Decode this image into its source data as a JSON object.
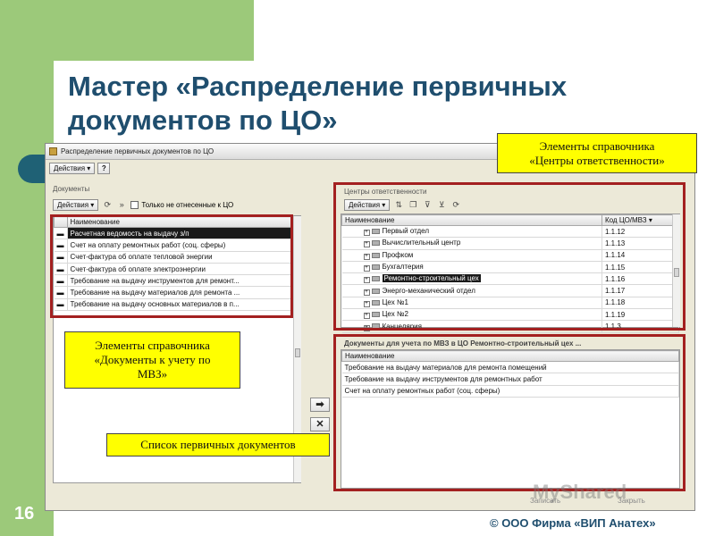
{
  "slide": {
    "title_line1": "Мастер «Распределение первичных",
    "title_line2": "документов по ЦО»",
    "number": "16",
    "footer": "© ООО Фирма «ВИП Анатех»",
    "colors": {
      "green": "#9cc97a",
      "title": "#1f4e6e",
      "frame_red": "#a32020",
      "callout_yellow": "#ffff00"
    }
  },
  "window": {
    "title": "Распределение первичных документов по ЦО",
    "actions_menu": "Действия",
    "help": "?",
    "save_label": "Записать",
    "close_label": "Закрыть"
  },
  "documents_panel": {
    "label": "Документы",
    "actions": "Действия",
    "filter_label": "Только не отнесенные к ЦО",
    "column": "Наименование",
    "rows": [
      "Расчетная ведомость на выдачу з/п",
      "Счет на оплату ремонтных работ (соц. сферы)",
      "Счет-фактура об оплате тепловой энергии",
      "Счет-фактура об оплате электроэнергии",
      "Требование на выдачу инструментов для ремонт...",
      "Требование на выдачу материалов для ремонта ...",
      "Требование на выдачу основных материалов в п..."
    ]
  },
  "centers_panel": {
    "label": "Центры ответственности",
    "actions": "Действия",
    "col_name": "Наименование",
    "col_code": "Код ЦО/МВЗ",
    "rows": [
      {
        "name": "Первый отдел",
        "code": "1.1.12"
      },
      {
        "name": "Вычислительный центр",
        "code": "1.1.13"
      },
      {
        "name": "Профком",
        "code": "1.1.14"
      },
      {
        "name": "Бухгалтерия",
        "code": "1.1.15"
      },
      {
        "name": "Ремонтно-строительный цех",
        "code": "1.1.16"
      },
      {
        "name": "Энерго-механический отдел",
        "code": "1.1.17"
      },
      {
        "name": "Цех №1",
        "code": "1.1.18"
      },
      {
        "name": "Цех №2",
        "code": "1.1.19"
      },
      {
        "name": "Канцелярия",
        "code": "1.1.3"
      }
    ]
  },
  "accounted_panel": {
    "label": "Документы для учета по МВЗ в ЦО Ремонтно-строительный цех ...",
    "column": "Наименование",
    "rows": [
      "Требование на выдачу материалов для ремонта помещений",
      "Требование на выдачу инструментов для ремонтных работ",
      "Счет на оплату ремонтных работ (соц. сферы)"
    ]
  },
  "callouts": {
    "centers_line1": "Элементы справочника",
    "centers_line2": "«Центры ответственности»",
    "docs_line1": "Элементы справочника",
    "docs_line2": "«Документы к учету по",
    "docs_line3": "МВЗ»",
    "list": "Список первичных документов"
  },
  "watermark": "MyShared"
}
